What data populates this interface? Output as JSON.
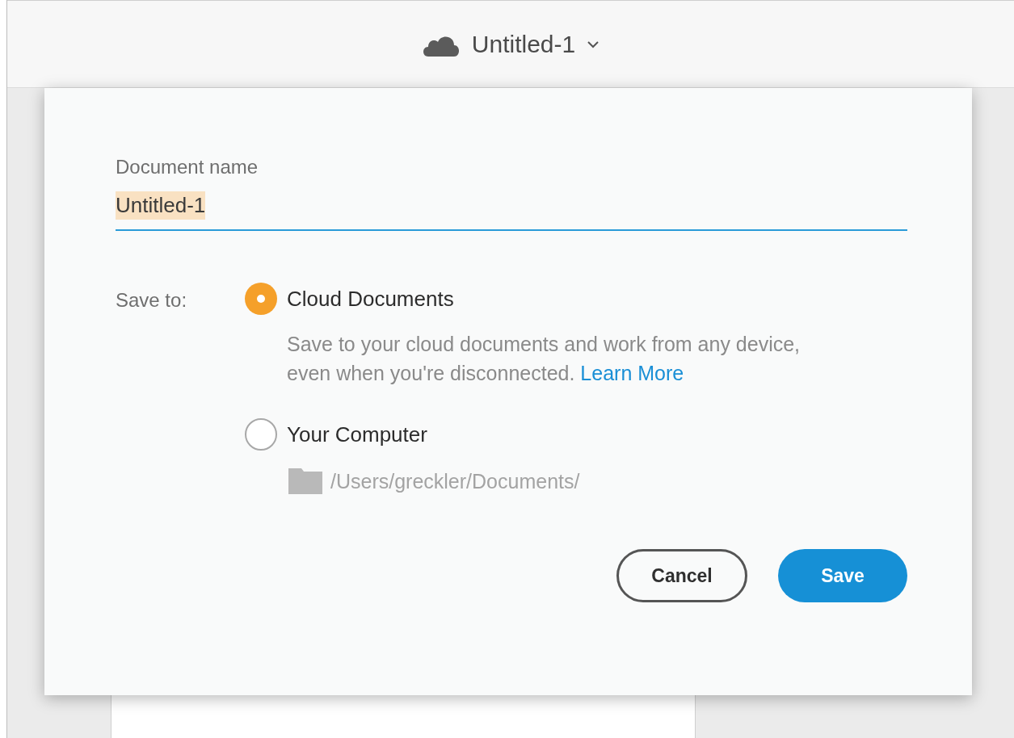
{
  "header": {
    "title": "Untitled-1"
  },
  "dialog": {
    "name_label": "Document name",
    "name_field": {
      "value": "Untitled-1",
      "text_selected": true,
      "focused": true
    },
    "save_to_label": "Save to:",
    "options": [
      {
        "kind": "description",
        "label": "Cloud Documents",
        "selected": true,
        "description": "Save to your cloud documents and work from any device, even when you're disconnected.",
        "link": "Learn More"
      },
      {
        "kind": "path",
        "label": "Your Computer",
        "selected": false,
        "path": "/Users/greckler/Documents/"
      }
    ],
    "buttons": [
      {
        "kind": "secondary",
        "label": "Cancel"
      },
      {
        "kind": "primary",
        "label": "Save"
      }
    ]
  }
}
